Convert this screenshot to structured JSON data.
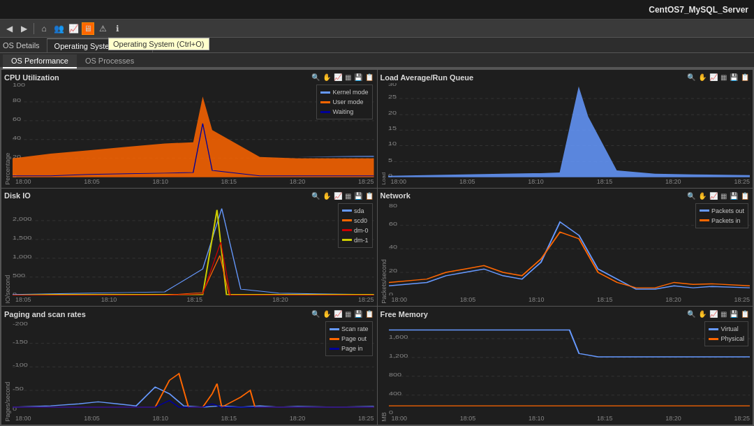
{
  "titlebar": {
    "server_name": "CentOS7_MySQL_Server"
  },
  "toolbar": {
    "icons": [
      "←",
      "→",
      "↑",
      "⌂",
      "👤",
      "📊",
      "🖥",
      "⚠",
      "!"
    ]
  },
  "tabs": {
    "os_details": "OS Details",
    "operating_system": "Operating System (Ctrl+O)"
  },
  "subtabs": {
    "os_performance": "OS Performance",
    "os_processes": "OS Processes"
  },
  "charts": {
    "cpu": {
      "title": "CPU Utilization",
      "y_label": "Percentage",
      "x_ticks": [
        "18:00",
        "18:05",
        "18:10",
        "18:15",
        "18:20",
        "18:25"
      ],
      "y_ticks": [
        "0",
        "20",
        "40",
        "60",
        "80",
        "100"
      ],
      "legend": [
        {
          "label": "Kernel mode",
          "color": "#6699ff"
        },
        {
          "label": "User mode",
          "color": "#ff6600"
        },
        {
          "label": "Waiting",
          "color": "#000066"
        }
      ]
    },
    "load": {
      "title": "Load Average/Run Queue",
      "y_label": "Load",
      "x_ticks": [
        "18:00",
        "18:05",
        "18:10",
        "18:15",
        "18:20",
        "18:25"
      ],
      "y_ticks": [
        "0",
        "5",
        "10",
        "15",
        "20",
        "25",
        "30"
      ],
      "legend": []
    },
    "disk": {
      "title": "Disk IO",
      "y_label": "IO/second",
      "x_ticks": [
        "18:05",
        "18:10",
        "18:15",
        "18:20",
        "18:25"
      ],
      "y_ticks": [
        "0",
        "500",
        "1,000",
        "1,500",
        "2,000"
      ],
      "legend": [
        {
          "label": "sda",
          "color": "#6699ff"
        },
        {
          "label": "scd0",
          "color": "#ff6600"
        },
        {
          "label": "dm-0",
          "color": "#cc0000"
        },
        {
          "label": "dm-1",
          "color": "#cccc00"
        }
      ]
    },
    "network": {
      "title": "Network",
      "y_label": "Packets/second",
      "x_ticks": [
        "18:00",
        "18:05",
        "18:10",
        "18:15",
        "18:20",
        "18:25"
      ],
      "y_ticks": [
        "0",
        "20",
        "40",
        "60",
        "80"
      ],
      "legend": [
        {
          "label": "Packets out",
          "color": "#6699ff"
        },
        {
          "label": "Packets in",
          "color": "#ff6600"
        }
      ]
    },
    "paging": {
      "title": "Paging and scan rates",
      "y_label": "Pages/second",
      "x_ticks": [
        "18:00",
        "18:05",
        "18:10",
        "18:15",
        "18:20",
        "18:25"
      ],
      "y_ticks": [
        "-200",
        "-150",
        "-100",
        "-50",
        "0"
      ],
      "legend": [
        {
          "label": "Scan rate",
          "color": "#6699ff"
        },
        {
          "label": "Page out",
          "color": "#ff6600"
        },
        {
          "label": "Page in",
          "color": "#000066"
        }
      ]
    },
    "memory": {
      "title": "Free Memory",
      "y_label": "MB",
      "x_ticks": [
        "18:00",
        "18:05",
        "18:10",
        "18:15",
        "18:20",
        "18:25"
      ],
      "y_ticks": [
        "0",
        "400",
        "800",
        "1,200",
        "1,600"
      ],
      "legend": [
        {
          "label": "Virtual",
          "color": "#6699ff"
        },
        {
          "label": "Physical",
          "color": "#ff6600"
        }
      ]
    }
  }
}
